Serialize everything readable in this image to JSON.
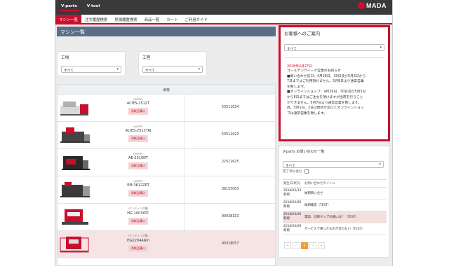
{
  "header": {
    "brand_tabs": [
      "V-parts",
      "V-tool"
    ],
    "logo_text": "MADA"
  },
  "nav": {
    "items": [
      "マシン一覧",
      "注文履歴検索",
      "見積履歴検索",
      "商品一覧",
      "カート",
      "ご利用ガイド"
    ],
    "active_index": 0
  },
  "main": {
    "title": "マシン一覧",
    "filters": [
      {
        "label": "工場",
        "value": "すべて"
      },
      {
        "label": "工程",
        "value": "すべて"
      }
    ],
    "table_header": "機種",
    "buy_label": "消耗品購入",
    "rows": [
      {
        "tag": "(AMTP)",
        "model": "ACIES-2512T",
        "number": "53511024"
      },
      {
        "tag": "(AMTP)",
        "model": "ACIES-2512TAJ",
        "number": "53511023"
      },
      {
        "tag": "(AMTP)",
        "model": "AE-2510NT",
        "number": "22511625"
      },
      {
        "tag": "(AMTP)",
        "model": "EM-3612ZRT",
        "number": "36155003"
      },
      {
        "tag": "(ベンディング機)",
        "model": "HG-1003ATC",
        "number": "90038153"
      },
      {
        "tag": "(ベンディング機)",
        "model": "HG2204ARm",
        "number": "90318057"
      }
    ]
  },
  "notice": {
    "title": "お客様へのご案内",
    "select_value": "すべて",
    "date": "2018年4月27日",
    "lines": [
      "ゴールデンウイーク営業のお知らせ",
      "■問い合わせ窓口：4月28日、30日及び5月3日から",
      "7日まではご利用頂けません。5月8日より通常営業",
      "を致します。",
      "■オンラインショップ：4月29日、30日及び5月3日",
      "から6日まではご注文を頂けますが出荷を行うこと",
      "ができません。5月7日より通常営業を致します。",
      "尚、5月1日、2日は問合せ窓口とオンラインショッ",
      "プは通常営業を致します。"
    ]
  },
  "inquiry": {
    "title": "V-parts お問い合わせ一覧",
    "select_value": "すべて",
    "completed_label": "完了済み含む",
    "headers": [
      "発生日/状況",
      "お問い合わせタイトル"
    ],
    "rows": [
      {
        "date": "2018/03/13",
        "status": "新規",
        "title": "納期問い合せ"
      },
      {
        "date": "2018/03/06",
        "status": "新規",
        "title": "納期確認（TEST）"
      },
      {
        "date": "2018/03/06",
        "status": "新規",
        "title": "電源、切断タップの違いは？（TEST）"
      },
      {
        "date": "2018/03/06",
        "status": "新規",
        "title": "サービスで買ったものが合わない（TEST）"
      }
    ],
    "pager": [
      "«",
      "‹",
      "1",
      "›",
      "»"
    ],
    "current_page": "1"
  },
  "colors": {
    "brand_red": "#c8102e",
    "title_bar": "#5a6e87",
    "page_current": "#f0a030"
  }
}
